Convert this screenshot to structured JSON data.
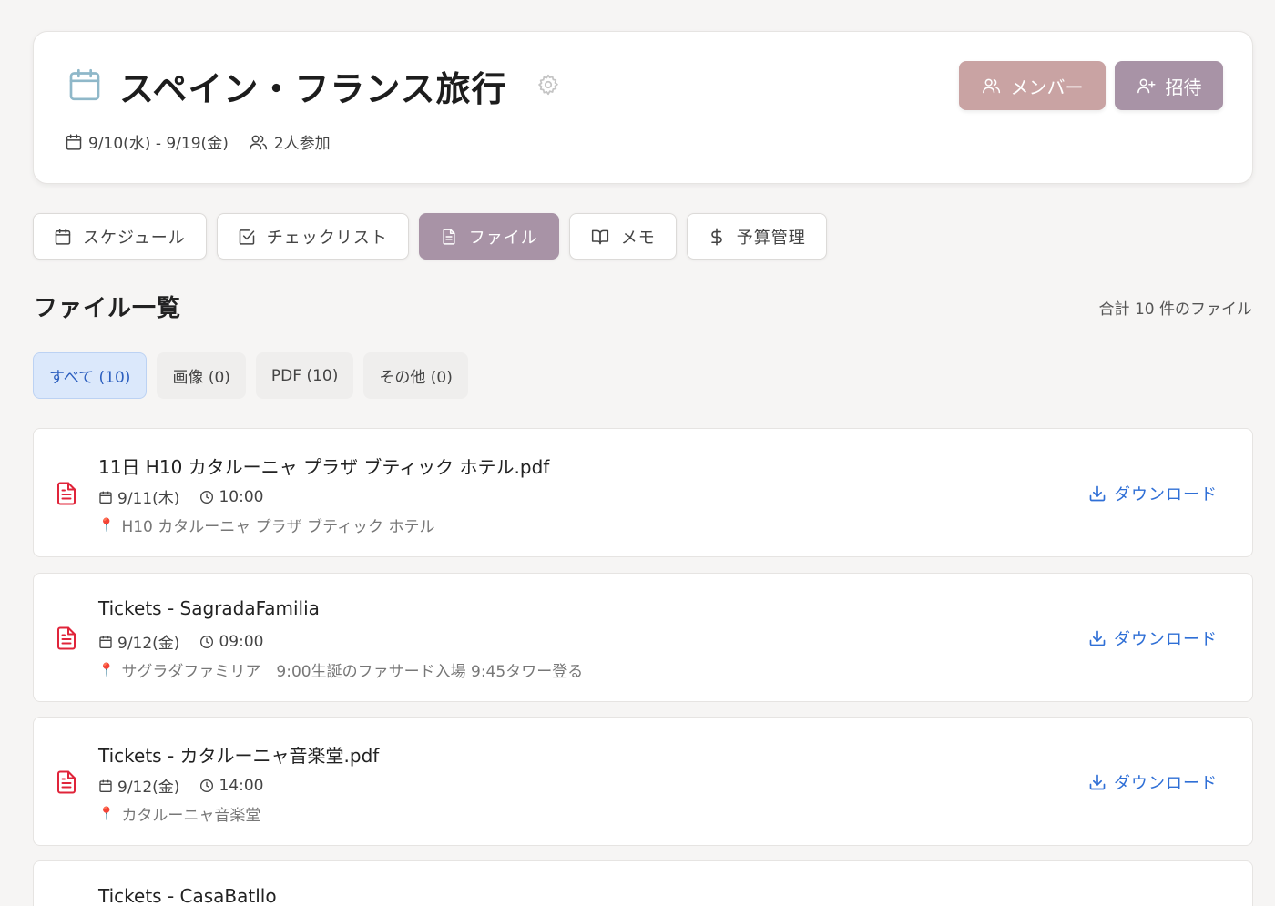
{
  "header": {
    "title": "スペイン・フランス旅行",
    "dates": "9/10(水) - 9/19(金)",
    "participants": "2人参加",
    "member_label": "メンバー",
    "invite_label": "招待"
  },
  "tabs": [
    {
      "label": "スケジュール",
      "icon": "calendar-icon"
    },
    {
      "label": "チェックリスト",
      "icon": "checkbox-icon"
    },
    {
      "label": "ファイル",
      "icon": "file-icon",
      "active": true
    },
    {
      "label": "メモ",
      "icon": "book-icon"
    },
    {
      "label": "予算管理",
      "icon": "dollar-icon"
    }
  ],
  "section": {
    "title": "ファイル一覧",
    "total": "合計 10 件のファイル"
  },
  "filters": [
    {
      "label": "すべて (10)",
      "active": true
    },
    {
      "label": "画像 (0)"
    },
    {
      "label": "PDF (10)"
    },
    {
      "label": "その他 (0)"
    }
  ],
  "files": [
    {
      "name": "11日 H10 カタルーニャ プラザ ブティック ホテル.pdf",
      "date": "9/11(木)",
      "time": "10:00",
      "location": "H10 カタルーニャ プラザ ブティック ホテル"
    },
    {
      "name": "Tickets - SagradaFamilia",
      "date": "9/12(金)",
      "time": "09:00",
      "location": "サグラダファミリア　9:00生誕のファサード入場 9:45タワー登る"
    },
    {
      "name": "Tickets - カタルーニャ音楽堂.pdf",
      "date": "9/12(金)",
      "time": "14:00",
      "location": "カタルーニャ音楽堂"
    },
    {
      "name": "Tickets - CasaBatllo",
      "date": "",
      "time": "",
      "location": ""
    }
  ],
  "download_label": "ダウンロード",
  "colors": {
    "accent_member": "#c9a3a3",
    "accent_invite": "#a893a6",
    "link_blue": "#2f6fd6",
    "pdf_red": "#e0243a"
  }
}
